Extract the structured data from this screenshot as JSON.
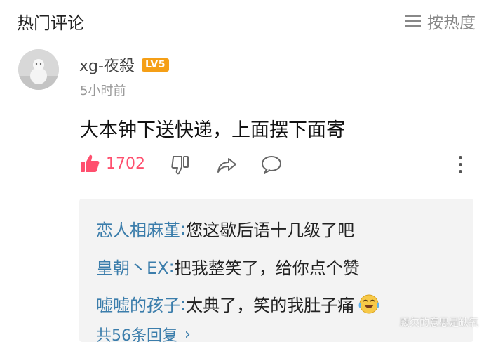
{
  "header": {
    "title": "热门评论",
    "sort_label": "按热度",
    "sort_icon": "list-icon"
  },
  "comment": {
    "username": "xg-夜殺",
    "level_badge": "LV5",
    "timestamp": "5小时前",
    "text": "大本钟下送快递，上面摆下面寄",
    "like_count": "1702"
  },
  "replies": {
    "items": [
      {
        "name": "恋人相麻堇",
        "sep": ":",
        "text": " 您这歇后语十几级了吧"
      },
      {
        "name": "皇朝丶EX",
        "sep": ":",
        "text": " 把我整笑了，给你点个赞"
      },
      {
        "name": "嘘嘘的孩子",
        "sep": ":",
        "text": " 太典了，笑的我肚子痛"
      }
    ],
    "total_label": "共56条回复",
    "chevron": "›"
  },
  "watermark": "殿欠的意思是缺氧",
  "colors": {
    "accent_link": "#3b7dab",
    "like_pink": "#ff4f6e",
    "badge_orange": "#f59f16"
  }
}
